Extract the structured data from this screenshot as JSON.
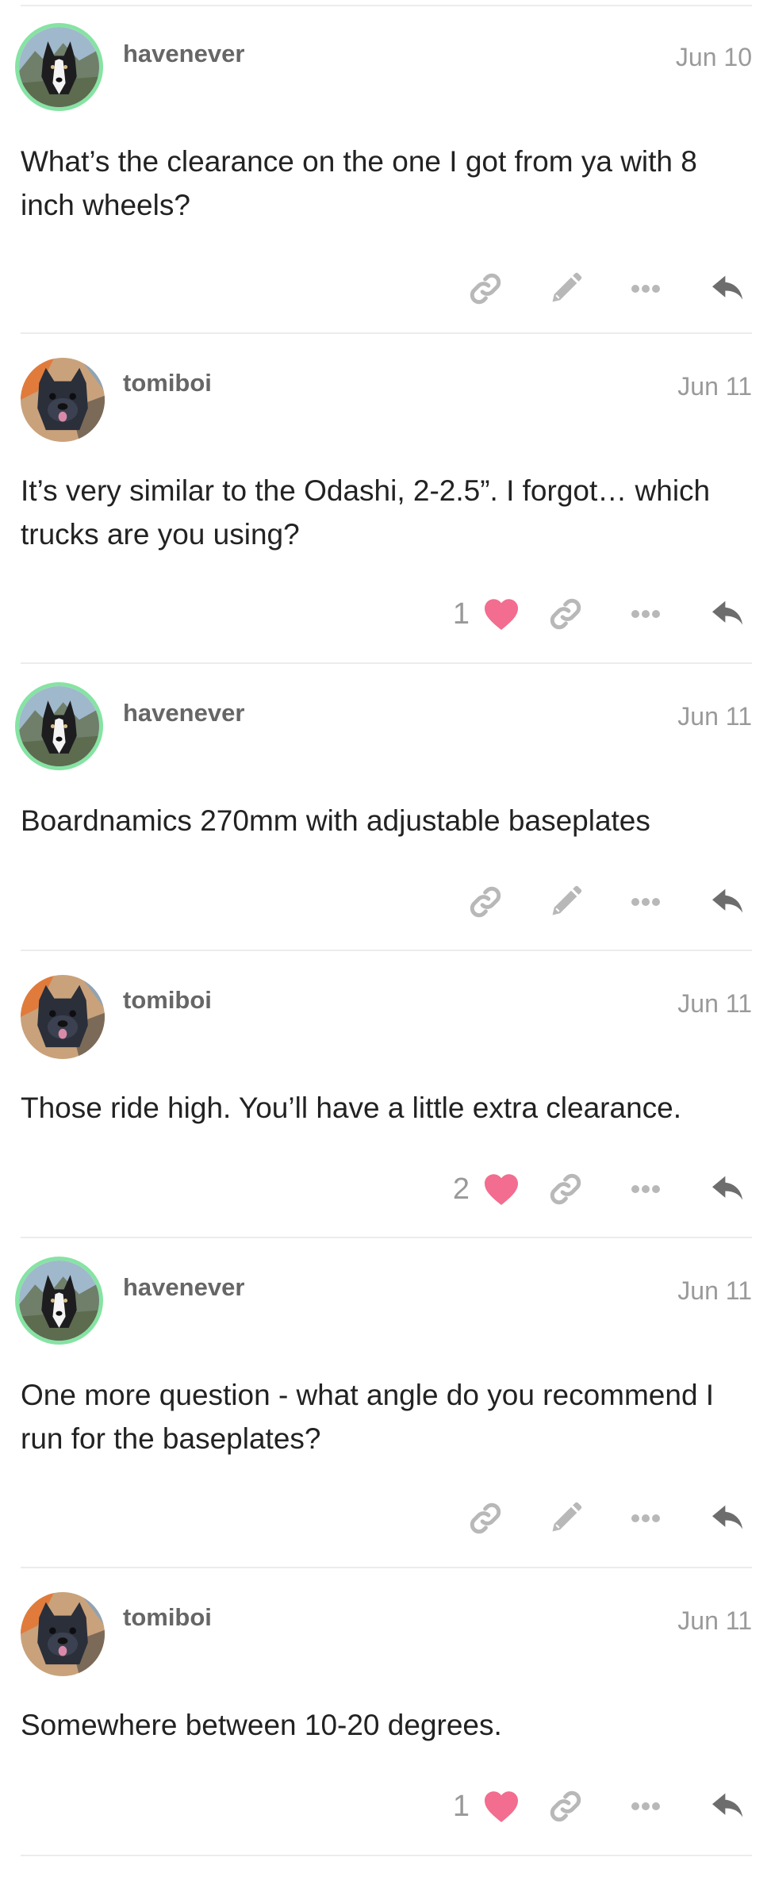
{
  "posts": [
    {
      "username": "havenever",
      "date": "Jun 10",
      "text": "What’s the clearance on the one I got from ya with 8 inch wheels?",
      "likes": "",
      "liked": false,
      "editable": true,
      "avatar": "husky-dog-avatar",
      "avatar_ring_color": "#86e3a3"
    },
    {
      "username": "tomiboi",
      "date": "Jun 11",
      "text": "It’s very similar to the Odashi, 2-2.5”. I forgot… which trucks are you using?",
      "likes": "1",
      "liked": true,
      "editable": false,
      "avatar": "bulldog-avatar"
    },
    {
      "username": "havenever",
      "date": "Jun 11",
      "text": "Boardnamics 270mm with adjustable baseplates",
      "likes": "",
      "liked": false,
      "editable": true,
      "avatar": "husky-dog-avatar",
      "avatar_ring_color": "#86e3a3"
    },
    {
      "username": "tomiboi",
      "date": "Jun 11",
      "text": "Those ride high. You’ll have a little extra clearance.",
      "likes": "2",
      "liked": true,
      "editable": false,
      "avatar": "bulldog-avatar"
    },
    {
      "username": "havenever",
      "date": "Jun 11",
      "text": "One more question - what angle do you recommend I run for the baseplates?",
      "likes": "",
      "liked": false,
      "editable": true,
      "avatar": "husky-dog-avatar",
      "avatar_ring_color": "#86e3a3"
    },
    {
      "username": "tomiboi",
      "date": "Jun 11",
      "text": "Somewhere between 10-20 degrees.",
      "likes": "1",
      "liked": true,
      "editable": false,
      "avatar": "bulldog-avatar"
    }
  ],
  "colors": {
    "heart": "#f26d8f",
    "icon": "#b8b8b8",
    "reply_icon": "#6d6d6d",
    "separator": "#ececec"
  },
  "icons": {
    "link": "link-icon",
    "edit": "pencil-icon",
    "more": "ellipsis-icon",
    "reply": "reply-arrow-icon",
    "like": "heart-icon"
  }
}
